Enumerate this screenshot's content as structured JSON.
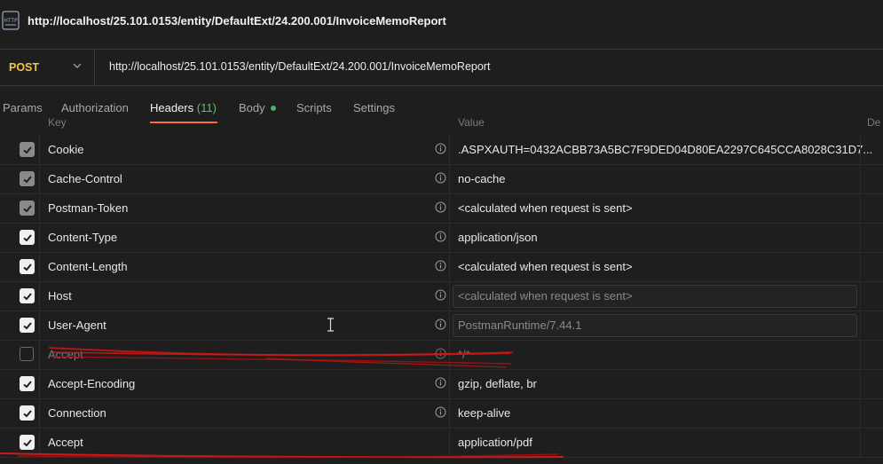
{
  "window": {
    "title_url": "http://localhost/25.101.0153/entity/DefaultExt/24.200.001/InvoiceMemoReport",
    "icon": "http-icon"
  },
  "request": {
    "method": "POST",
    "url": "http://localhost/25.101.0153/entity/DefaultExt/24.200.001/InvoiceMemoReport"
  },
  "tabs": [
    {
      "label": "Params"
    },
    {
      "label": "Authorization"
    },
    {
      "label": "Headers",
      "count": "(11)"
    },
    {
      "label": "Body"
    },
    {
      "label": "Scripts"
    },
    {
      "label": "Settings"
    }
  ],
  "columns": {
    "key": "Key",
    "value": "Value",
    "description": "De"
  },
  "headers": [
    {
      "checked": "dim",
      "key": "Cookie",
      "value": ".ASPXAUTH=0432ACBB73A5BC7F9DED04D80EA2297C645CCA8028C31D7..."
    },
    {
      "checked": "dim",
      "key": "Cache-Control",
      "value": "no-cache"
    },
    {
      "checked": "dim",
      "key": "Postman-Token",
      "value": "<calculated when request is sent>"
    },
    {
      "checked": "on",
      "key": "Content-Type",
      "value": "application/json"
    },
    {
      "checked": "on",
      "key": "Content-Length",
      "value": "<calculated when request is sent>"
    },
    {
      "checked": "on",
      "key": "Host",
      "value": "<calculated when request is sent>"
    },
    {
      "checked": "on",
      "key": "User-Agent",
      "value": "PostmanRuntime/7.44.1"
    },
    {
      "checked": "off",
      "key": "Accept",
      "value": "*/*"
    },
    {
      "checked": "on",
      "key": "Accept-Encoding",
      "value": "gzip, deflate, br"
    },
    {
      "checked": "on",
      "key": "Connection",
      "value": "keep-alive"
    },
    {
      "checked": "on",
      "key": "Accept",
      "value": "application/pdf"
    }
  ],
  "colors": {
    "method": "#f5c444",
    "active_tab_underline": "#ff6c37",
    "count": "#5fbf72",
    "annotation": "#d11a1a"
  }
}
